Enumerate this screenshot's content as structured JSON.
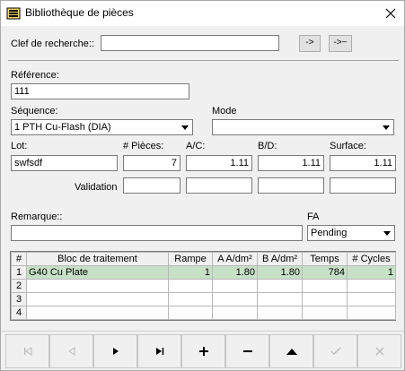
{
  "window": {
    "title": "Bibliothèque de pièces",
    "title_icon": "folder-stack-icon",
    "close_icon": "close-icon"
  },
  "search": {
    "label": "Clef de recherche::",
    "value": "",
    "btn_next": "->",
    "btn_next_approx": "->~"
  },
  "reference": {
    "label": "Référence:",
    "value": "111"
  },
  "sequence": {
    "label": "Séquence:",
    "value": "1 PTH Cu-Flash (DIA)"
  },
  "mode": {
    "label": "Mode",
    "value": ""
  },
  "lot": {
    "label": "Lot:",
    "value": "swfsdf"
  },
  "pieces": {
    "label": "# Pièces:",
    "value": "7"
  },
  "ac": {
    "label": "A/C:",
    "value": "1.11"
  },
  "bd": {
    "label": "B/D:",
    "value": "1.11"
  },
  "surface": {
    "label": "Surface:",
    "value": "1.11"
  },
  "validation": {
    "label": "Validation"
  },
  "remarque": {
    "label": "Remarque::",
    "value": ""
  },
  "fa": {
    "label": "FA",
    "value": "Pending"
  },
  "table": {
    "headers": [
      "#",
      "Bloc de traitement",
      "Rampe",
      "A A/dm²",
      "B A/dm²",
      "Temps",
      "# Cycles"
    ],
    "rows": [
      [
        "1",
        "G40 Cu Plate",
        "1",
        "1.80",
        "1.80",
        "784",
        "1"
      ],
      [
        "2",
        "",
        "",
        "",
        "",
        "",
        ""
      ],
      [
        "3",
        "",
        "",
        "",
        "",
        "",
        ""
      ],
      [
        "4",
        "",
        "",
        "",
        "",
        "",
        ""
      ]
    ],
    "selected_row_color": "#c7e1c7"
  },
  "toolbar": {
    "buttons": [
      {
        "name": "first-record-button",
        "icon": "skip-to-start-icon",
        "enabled": false
      },
      {
        "name": "previous-record-button",
        "icon": "previous-icon",
        "enabled": false
      },
      {
        "name": "next-record-button",
        "icon": "next-icon",
        "enabled": true
      },
      {
        "name": "last-record-button",
        "icon": "skip-to-end-icon",
        "enabled": true
      },
      {
        "name": "add-record-button",
        "icon": "plus-icon",
        "enabled": true
      },
      {
        "name": "delete-record-button",
        "icon": "minus-icon",
        "enabled": true
      },
      {
        "name": "edit-record-button",
        "icon": "triangle-up-icon",
        "enabled": true
      },
      {
        "name": "confirm-button",
        "icon": "checkmark-icon",
        "enabled": false
      },
      {
        "name": "cancel-button",
        "icon": "x-mark-icon",
        "enabled": false
      }
    ]
  }
}
